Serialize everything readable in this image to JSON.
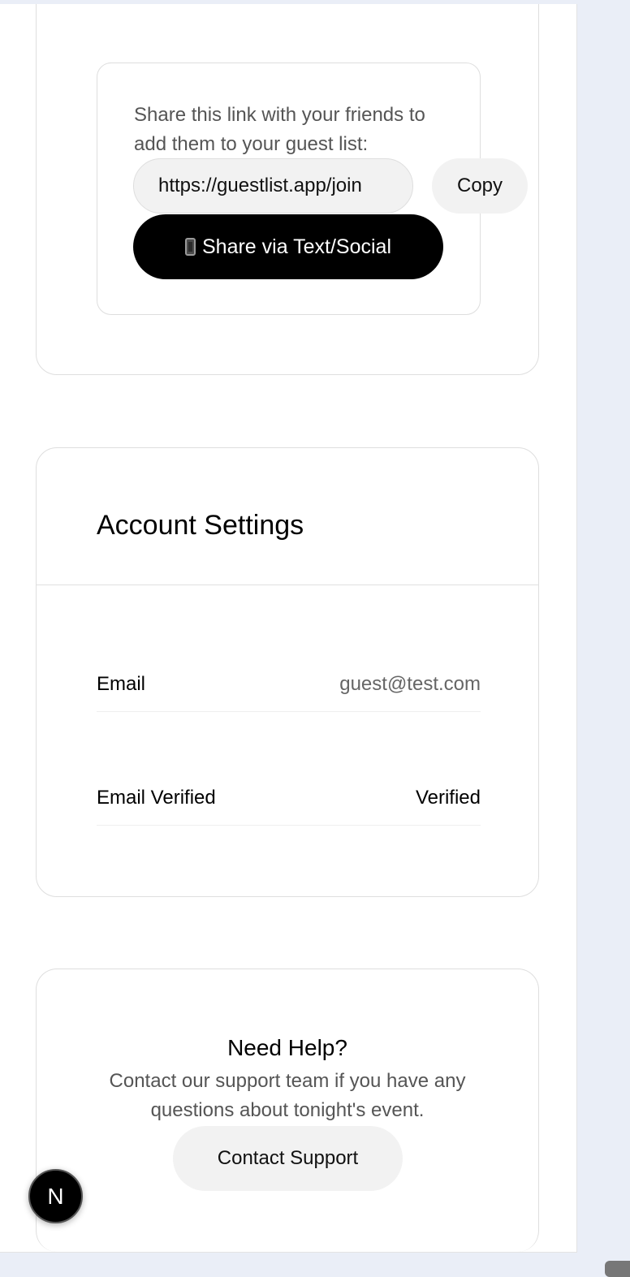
{
  "share": {
    "instructions": "Share this link with your friends to add them to your guest list:",
    "link_value": "https://guestlist.app/join",
    "copy_label": "Copy",
    "share_label": "Share via Text/Social"
  },
  "account": {
    "title": "Account Settings",
    "rows": [
      {
        "label": "Email",
        "value": "guest@test.com"
      },
      {
        "label": "Email Verified",
        "value": "Verified"
      }
    ]
  },
  "help": {
    "title": "Need Help?",
    "text": "Contact our support team if you have any questions about tonight's event.",
    "button_label": "Contact Support"
  },
  "devtools": {
    "badge_letter": "N"
  }
}
